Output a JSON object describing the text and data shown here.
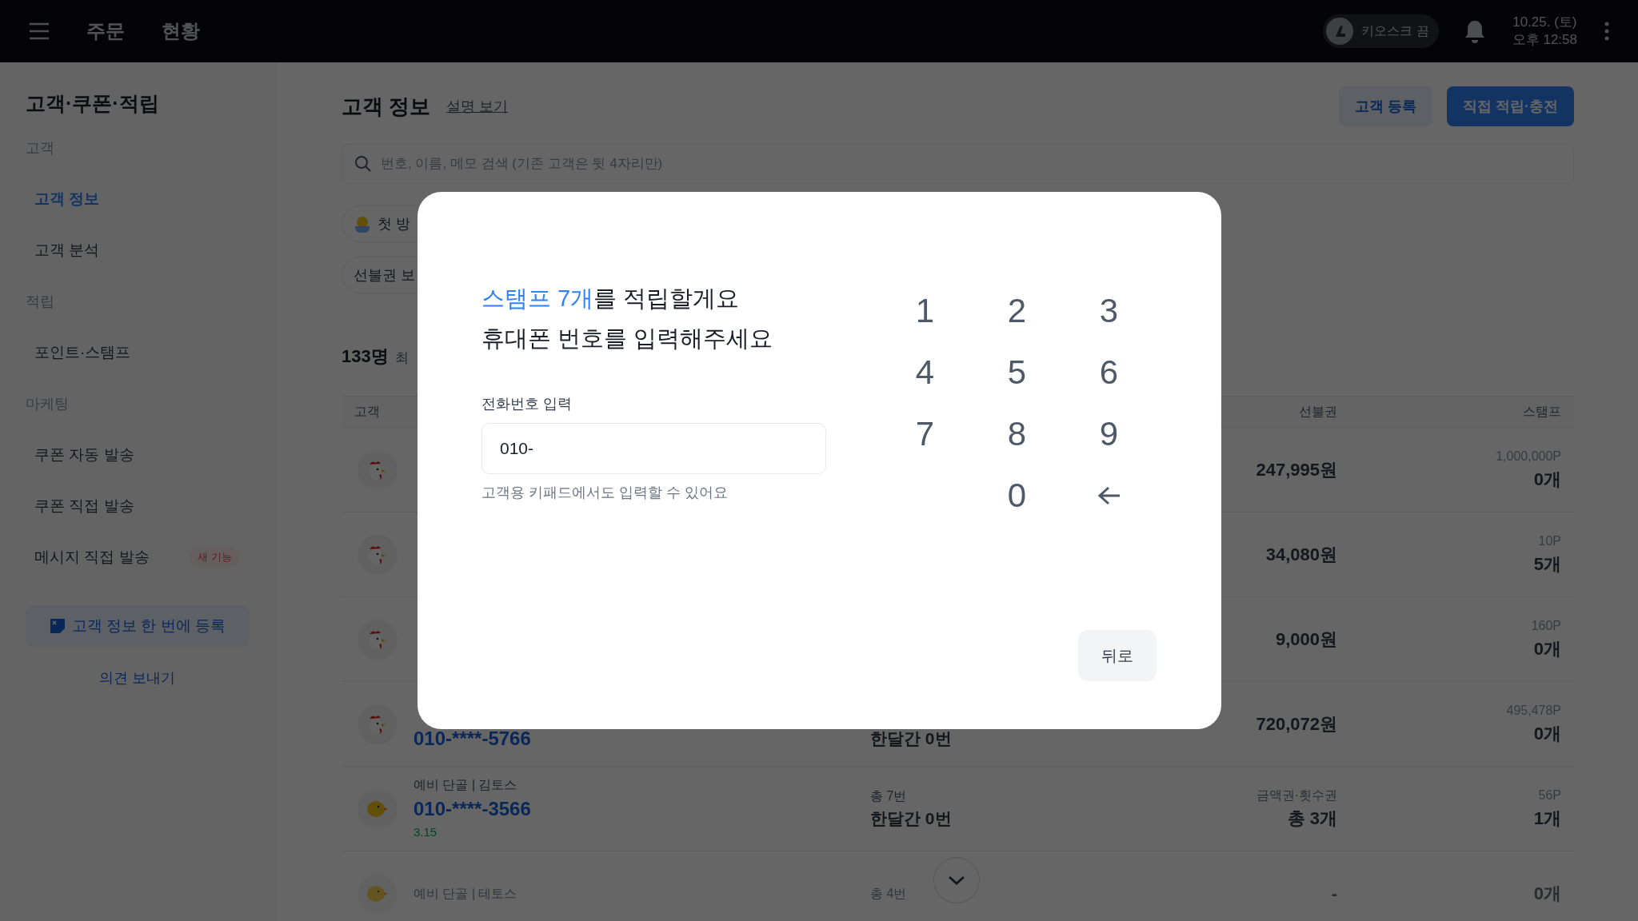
{
  "top_bar": {
    "nav": [
      {
        "label": "주문"
      },
      {
        "label": "현황"
      }
    ],
    "kiosk": {
      "label": "키오스크 끔",
      "on": false
    },
    "date": "10.25. (토)",
    "time": "오후 12:58"
  },
  "sidebar": {
    "title": "고객·쿠폰·적립",
    "sections": [
      {
        "label": "고객",
        "items": [
          {
            "label": "고객 정보",
            "selected": true
          },
          {
            "label": "고객 분석",
            "selected": false
          }
        ]
      },
      {
        "label": "적립",
        "items": [
          {
            "label": "포인트·스탬프",
            "selected": false
          }
        ]
      },
      {
        "label": "마케팅",
        "items": [
          {
            "label": "쿠폰 자동 발송",
            "selected": false
          },
          {
            "label": "쿠폰 직접 발송",
            "selected": false
          },
          {
            "label": "메시지 직접 발송",
            "selected": false,
            "badge": "새 기능"
          }
        ]
      }
    ],
    "bulk_button": "고객 정보 한 번에 등록",
    "feedback_button": "의견 보내기"
  },
  "page": {
    "title": "고객 정보",
    "help_link": "설명 보기",
    "buttons": [
      {
        "label": "고객 등록",
        "kind": "secondary"
      },
      {
        "label": "직접 적립·충전",
        "kind": "primary"
      }
    ],
    "search": {
      "placeholder": "번호, 이름, 메모 검색 (기존 고객은 뒷 4자리만)"
    },
    "chips": [
      {
        "label": "첫 방",
        "kind": "chick"
      },
      {
        "label": "선불권 보",
        "kind": "plain"
      }
    ],
    "count": "133명",
    "sort_label": "최",
    "table": {
      "columns": [
        "고객",
        "선불권",
        "스탬프"
      ],
      "rows": [
        {
          "kind": "rooster",
          "prepaid": "247,995원",
          "points": "1,000,000P",
          "stamps": "0개",
          "faded": false
        },
        {
          "kind": "rooster",
          "prepaid": "34,080원",
          "points": "10P",
          "stamps": "5개",
          "faded": false
        },
        {
          "kind": "rooster",
          "prepaid": "9,000원",
          "points": "160P",
          "stamps": "0개",
          "faded": false
        },
        {
          "kind": "rooster",
          "phone": "010-****-5766",
          "visits_month": "한달간 0번",
          "prepaid": "720,072원",
          "points": "495,478P",
          "stamps": "0개",
          "faded": false
        },
        {
          "kind": "chick",
          "group": "예비 단골 | 김토스",
          "phone": "010-****-3566",
          "date": "3.15",
          "visits_total": "총 7번",
          "visits_month": "한달간 0번",
          "prepaid_label": "금액권·횟수권",
          "prepaid": "총 3개",
          "points": "56P",
          "stamps": "1개",
          "faded": false
        },
        {
          "kind": "chick",
          "group": "예비 단골 | 테토스",
          "visits_total": "총 4번",
          "prepaid": "-",
          "stamps": "0개",
          "faded": true
        }
      ]
    }
  },
  "modal": {
    "title": "**스탬프 7개**를 적립할게요",
    "subtitle": "휴대폰 번호를 입력해주세요",
    "field_label": "전화번호 입력",
    "field_value": "010-",
    "hint": "고객용 키패드에서도 입력할 수 있어요",
    "keys": [
      {
        "kind": "digit",
        "label": "1"
      },
      {
        "kind": "digit",
        "label": "2"
      },
      {
        "kind": "digit",
        "label": "3"
      },
      {
        "kind": "digit",
        "label": "4"
      },
      {
        "kind": "digit",
        "label": "5"
      },
      {
        "kind": "digit",
        "label": "6"
      },
      {
        "kind": "digit",
        "label": "7"
      },
      {
        "kind": "digit",
        "label": "8"
      },
      {
        "kind": "digit",
        "label": "9"
      },
      {
        "kind": "blank"
      },
      {
        "kind": "digit",
        "label": "0"
      },
      {
        "kind": "backspace"
      }
    ],
    "back_button": "뒤로"
  }
}
